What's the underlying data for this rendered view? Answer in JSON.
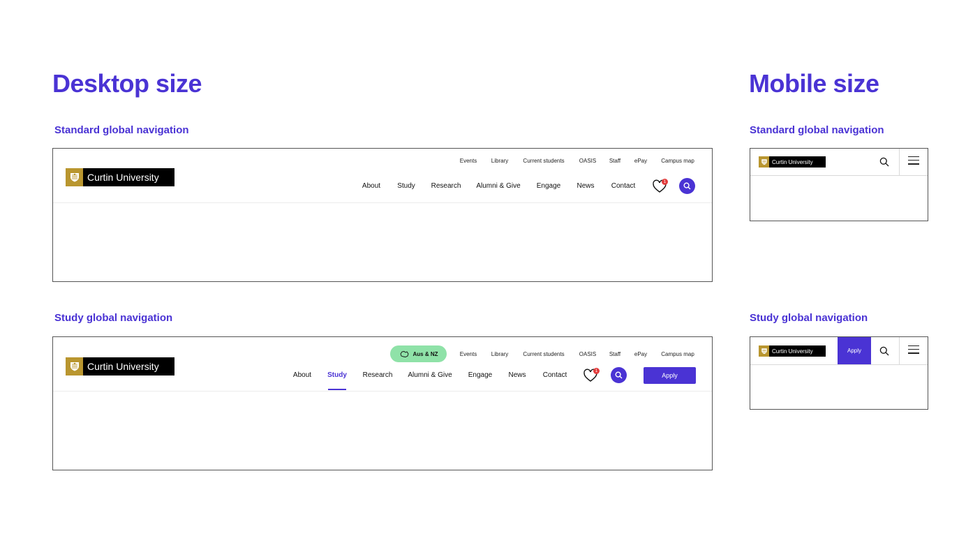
{
  "sections": {
    "desktop_title": "Desktop size",
    "mobile_title": "Mobile size",
    "standard_label": "Standard global navigation",
    "study_label": "Study global navigation"
  },
  "brand": {
    "name": "Curtin University"
  },
  "utility_nav": [
    "Events",
    "Library",
    "Current students",
    "OASIS",
    "Staff",
    "ePay",
    "Campus map"
  ],
  "standard_main_nav": [
    "About",
    "Study",
    "Research",
    "Alumni & Give",
    "Engage",
    "News",
    "Contact"
  ],
  "study_main_nav": [
    "About",
    "Study",
    "Research",
    "Alumni & Give",
    "Engage",
    "News",
    "Contact"
  ],
  "study_active_item": "Study",
  "shortlist_count": "1",
  "region_pill": "Aus & NZ",
  "apply_label": "Apply",
  "icons": [
    "crest-icon",
    "heart-icon",
    "search-icon",
    "australia-map-icon",
    "hamburger-menu-icon"
  ],
  "colors": {
    "accent": "#4a33d4",
    "crest_gold": "#b9962f",
    "pill_green": "#8fe2a8",
    "badge_red": "#e23b3b"
  }
}
